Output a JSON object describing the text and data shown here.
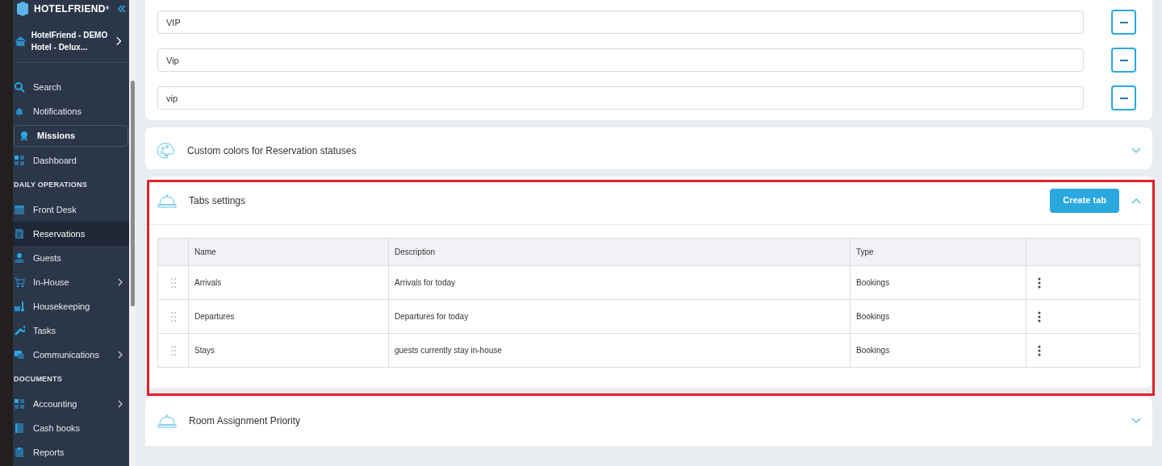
{
  "sidebar": {
    "brand": "HOTELFRIEND",
    "brand_mark": "®",
    "property": "HotelFriend - DEMO Hotel - Delux...",
    "items": [
      {
        "kind": "item",
        "label": "Search",
        "selected": false,
        "has_submenu": false
      },
      {
        "kind": "item",
        "label": "Notifications",
        "selected": false,
        "has_submenu": false
      },
      {
        "kind": "boxed",
        "label": "Missions",
        "selected": false,
        "has_submenu": false
      },
      {
        "kind": "item",
        "label": "Dashboard",
        "selected": false,
        "has_submenu": false
      },
      {
        "kind": "section",
        "label": "DAILY OPERATIONS"
      },
      {
        "kind": "item",
        "label": "Front Desk",
        "selected": false,
        "has_submenu": false
      },
      {
        "kind": "item",
        "label": "Reservations",
        "selected": true,
        "has_submenu": false
      },
      {
        "kind": "item",
        "label": "Guests",
        "selected": false,
        "has_submenu": false
      },
      {
        "kind": "item",
        "label": "In-House",
        "selected": false,
        "has_submenu": true
      },
      {
        "kind": "item",
        "label": "Housekeeping",
        "selected": false,
        "has_submenu": false
      },
      {
        "kind": "item",
        "label": "Tasks",
        "selected": false,
        "has_submenu": false
      },
      {
        "kind": "item",
        "label": "Communications",
        "selected": false,
        "has_submenu": true
      },
      {
        "kind": "section",
        "label": "DOCUMENTS"
      },
      {
        "kind": "item",
        "label": "Accounting",
        "selected": false,
        "has_submenu": true
      },
      {
        "kind": "item",
        "label": "Cash books",
        "selected": false,
        "has_submenu": false
      },
      {
        "kind": "item",
        "label": "Reports",
        "selected": false,
        "has_submenu": false
      }
    ]
  },
  "tag_fields": [
    {
      "value": "VIP"
    },
    {
      "value": "Vip"
    },
    {
      "value": "vip"
    }
  ],
  "sections": [
    {
      "title": "Custom colors for Reservation statuses",
      "expanded": false,
      "highlighted": false
    },
    {
      "title": "Tabs settings",
      "expanded": true,
      "highlighted": true,
      "button": "Create tab",
      "table": {
        "columns": [
          "Name",
          "Description",
          "Type"
        ],
        "rows": [
          [
            "Arrivals",
            "Arrivals for today",
            "Bookings"
          ],
          [
            "Departures",
            "Departures for today",
            "Bookings"
          ],
          [
            "Stays",
            "guests currently stay in-house",
            "Bookings"
          ]
        ]
      }
    },
    {
      "title": "Room Assignment Priority",
      "expanded": false,
      "highlighted": false
    }
  ]
}
